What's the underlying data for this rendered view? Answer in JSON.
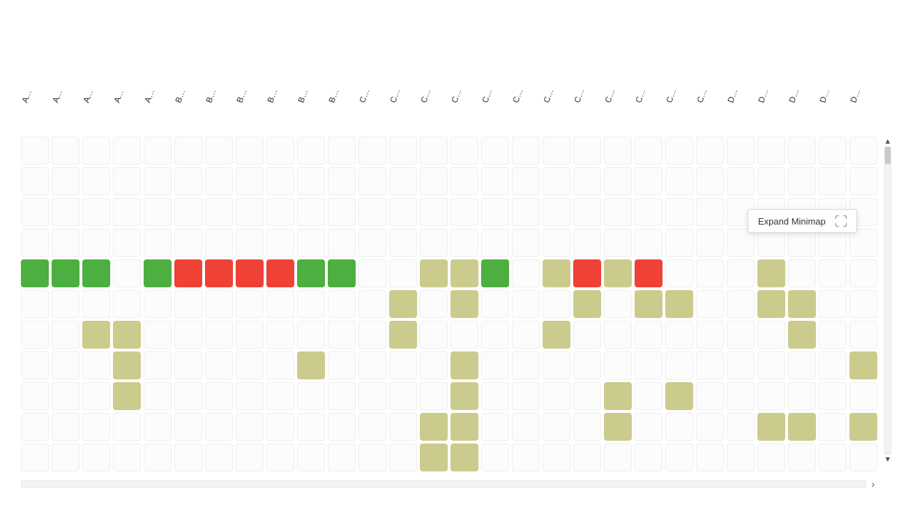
{
  "colors": {
    "empty": "#fcfcfc",
    "green": "#4CAF3F",
    "red": "#EF4136",
    "khaki": "#CCCB8E"
  },
  "tooltip": {
    "expand_minimap": "Expand Minimap"
  },
  "columns": [
    "ATVIE_Fallback...",
    "ATVIM_Fallbac...",
    "ATZTW_Fallbac...",
    "ATZWW_Fallba...",
    "Auditors",
    "Bags_systems",
    "BEDFL_Fallbac...",
    "BEPPR_Fallbac...",
    "BGSMB_Fallba...",
    "Bldg_Controls",
    "BYOD",
    "CHZFN_Fallbac...",
    "CIABI_Fallback...",
    "CMWBB",
    "CNTAC_Fallbac...",
    "Contractors",
    "Corporate",
    "Corporate_Visitor",
    "Critical",
    "CRM",
    "CZCSB_Fallbac...",
    "CZPRG_Fallbac...",
    "CZSTT_Fallbac...",
    "DACO",
    "DC_Fileservices",
    "DC_Infrastructu...",
    "DC_Management",
    "DC_Monitoring"
  ],
  "rows": [
    [
      "empty",
      "empty",
      "empty",
      "empty",
      "empty",
      "empty",
      "empty",
      "empty",
      "empty",
      "empty",
      "empty",
      "empty",
      "empty",
      "empty",
      "empty",
      "empty",
      "empty",
      "empty",
      "empty",
      "empty",
      "empty",
      "empty",
      "empty",
      "empty",
      "empty",
      "empty",
      "empty",
      "empty"
    ],
    [
      "empty",
      "empty",
      "empty",
      "empty",
      "empty",
      "empty",
      "empty",
      "empty",
      "empty",
      "empty",
      "empty",
      "empty",
      "empty",
      "empty",
      "empty",
      "empty",
      "empty",
      "empty",
      "empty",
      "empty",
      "empty",
      "empty",
      "empty",
      "empty",
      "empty",
      "empty",
      "empty",
      "empty"
    ],
    [
      "empty",
      "empty",
      "empty",
      "empty",
      "empty",
      "empty",
      "empty",
      "empty",
      "empty",
      "empty",
      "empty",
      "empty",
      "empty",
      "empty",
      "empty",
      "empty",
      "empty",
      "empty",
      "empty",
      "empty",
      "empty",
      "empty",
      "empty",
      "empty",
      "empty",
      "empty",
      "empty",
      "empty"
    ],
    [
      "empty",
      "empty",
      "empty",
      "empty",
      "empty",
      "empty",
      "empty",
      "empty",
      "empty",
      "empty",
      "empty",
      "empty",
      "empty",
      "empty",
      "empty",
      "empty",
      "empty",
      "empty",
      "empty",
      "empty",
      "empty",
      "empty",
      "empty",
      "empty",
      "empty",
      "empty",
      "empty",
      "empty"
    ],
    [
      "green",
      "green",
      "green",
      "empty",
      "green",
      "red",
      "red",
      "red",
      "red",
      "green",
      "green",
      "empty",
      "empty",
      "khaki",
      "khaki",
      "green",
      "empty",
      "khaki",
      "red",
      "khaki",
      "red",
      "empty",
      "empty",
      "empty",
      "khaki",
      "empty",
      "empty",
      "empty"
    ],
    [
      "empty",
      "empty",
      "empty",
      "empty",
      "empty",
      "empty",
      "empty",
      "empty",
      "empty",
      "empty",
      "empty",
      "empty",
      "khaki",
      "empty",
      "khaki",
      "empty",
      "empty",
      "empty",
      "khaki",
      "empty",
      "khaki",
      "khaki",
      "empty",
      "empty",
      "khaki",
      "khaki",
      "empty",
      "empty"
    ],
    [
      "empty",
      "empty",
      "khaki",
      "khaki",
      "empty",
      "empty",
      "empty",
      "empty",
      "empty",
      "empty",
      "empty",
      "empty",
      "khaki",
      "empty",
      "empty",
      "empty",
      "empty",
      "khaki",
      "empty",
      "empty",
      "empty",
      "empty",
      "empty",
      "empty",
      "empty",
      "khaki",
      "empty",
      "empty"
    ],
    [
      "empty",
      "empty",
      "empty",
      "khaki",
      "empty",
      "empty",
      "empty",
      "empty",
      "empty",
      "khaki",
      "empty",
      "empty",
      "empty",
      "empty",
      "khaki",
      "empty",
      "empty",
      "empty",
      "empty",
      "empty",
      "empty",
      "empty",
      "empty",
      "empty",
      "empty",
      "empty",
      "empty",
      "khaki"
    ],
    [
      "empty",
      "empty",
      "empty",
      "khaki",
      "empty",
      "empty",
      "empty",
      "empty",
      "empty",
      "empty",
      "empty",
      "empty",
      "empty",
      "empty",
      "khaki",
      "empty",
      "empty",
      "empty",
      "empty",
      "khaki",
      "empty",
      "khaki",
      "empty",
      "empty",
      "empty",
      "empty",
      "empty",
      "empty"
    ],
    [
      "empty",
      "empty",
      "empty",
      "empty",
      "empty",
      "empty",
      "empty",
      "empty",
      "empty",
      "empty",
      "empty",
      "empty",
      "empty",
      "khaki",
      "khaki",
      "empty",
      "empty",
      "empty",
      "empty",
      "khaki",
      "empty",
      "empty",
      "empty",
      "empty",
      "khaki",
      "khaki",
      "empty",
      "khaki"
    ],
    [
      "empty",
      "empty",
      "empty",
      "empty",
      "empty",
      "empty",
      "empty",
      "empty",
      "empty",
      "empty",
      "empty",
      "empty",
      "empty",
      "khaki",
      "khaki",
      "empty",
      "empty",
      "empty",
      "empty",
      "empty",
      "empty",
      "empty",
      "empty",
      "empty",
      "empty",
      "empty",
      "empty",
      "empty"
    ]
  ]
}
